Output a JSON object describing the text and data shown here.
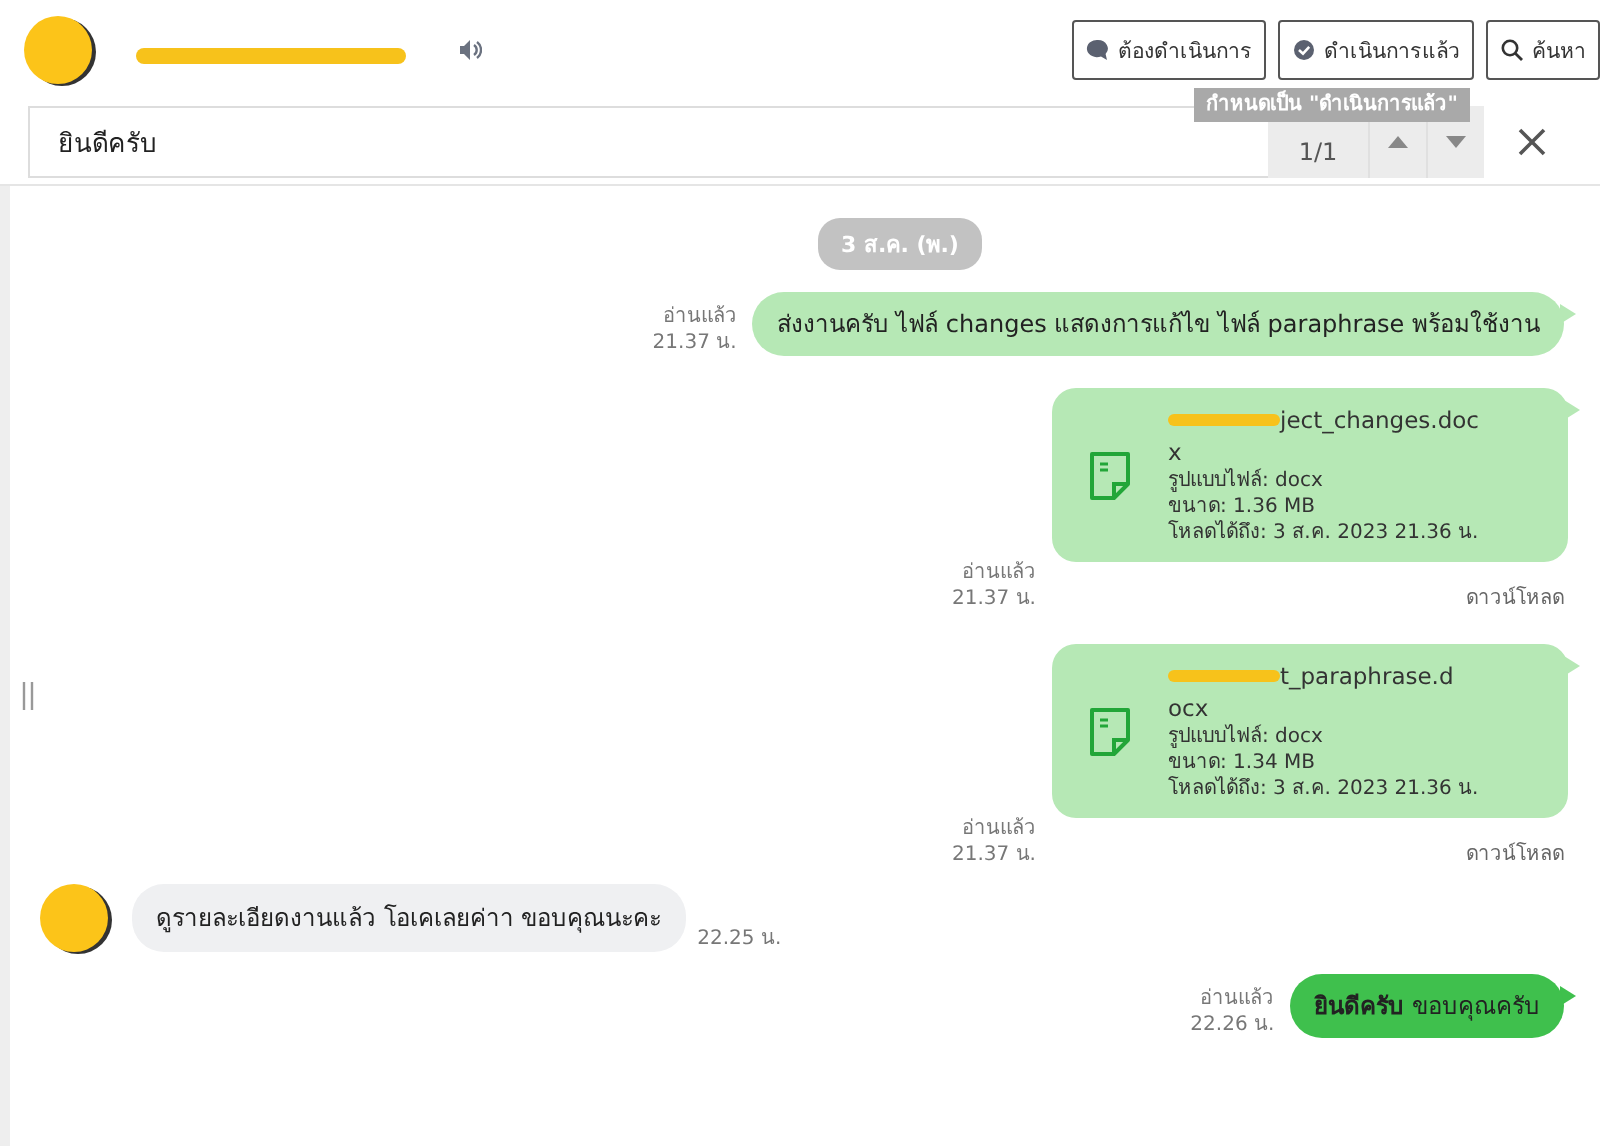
{
  "header": {
    "buttons": [
      {
        "label": "ต้องดำเนินการ"
      },
      {
        "label": "ดำเนินการแล้ว"
      },
      {
        "label": "ค้นหา"
      }
    ],
    "tooltip": "กำหนดเป็น \"ดำเนินการแล้ว\""
  },
  "search": {
    "value": "ยินดีครับ",
    "count": "1/1"
  },
  "messages": [
    {
      "kind": "date",
      "text": "3 ส.ค. (พ.)"
    },
    {
      "kind": "text",
      "incoming": false,
      "text": "ส่งงานครับ ไฟล์ changes แสดงการแก้ไข ไฟล์ paraphrase พร้อมใช้งาน",
      "status": "อ่านแล้ว",
      "time": "21.37 น."
    },
    {
      "kind": "file",
      "incoming": false,
      "name": [
        "ject_changes.doc",
        "x"
      ],
      "type": "รูปแบบไฟล์: docx",
      "size": "ขนาด: 1.36 MB",
      "expiry": "โหลดได้ถึง: 3 ส.ค. 2023 21.36 น.",
      "status": "อ่านแล้ว",
      "time": "21.37 น.",
      "download": "ดาวน์โหลด"
    },
    {
      "kind": "file",
      "incoming": false,
      "name": [
        "t_paraphrase.d",
        "ocx"
      ],
      "type": "รูปแบบไฟล์: docx",
      "size": "ขนาด: 1.34 MB",
      "expiry": "โหลดได้ถึง: 3 ส.ค. 2023 21.36 น.",
      "status": "อ่านแล้ว",
      "time": "21.37 น.",
      "download": "ดาวน์โหลด"
    },
    {
      "kind": "text",
      "incoming": true,
      "text": "ดูรายละเอียดงานแล้ว โอเคเลยค่าา ขอบคุณนะคะ",
      "time": "22.25 น."
    },
    {
      "kind": "text",
      "incoming": false,
      "highlight": true,
      "text": "**ยินดีครับ** ขอบคุณครับ",
      "status": "อ่านแล้ว",
      "time": "22.26 น."
    }
  ]
}
